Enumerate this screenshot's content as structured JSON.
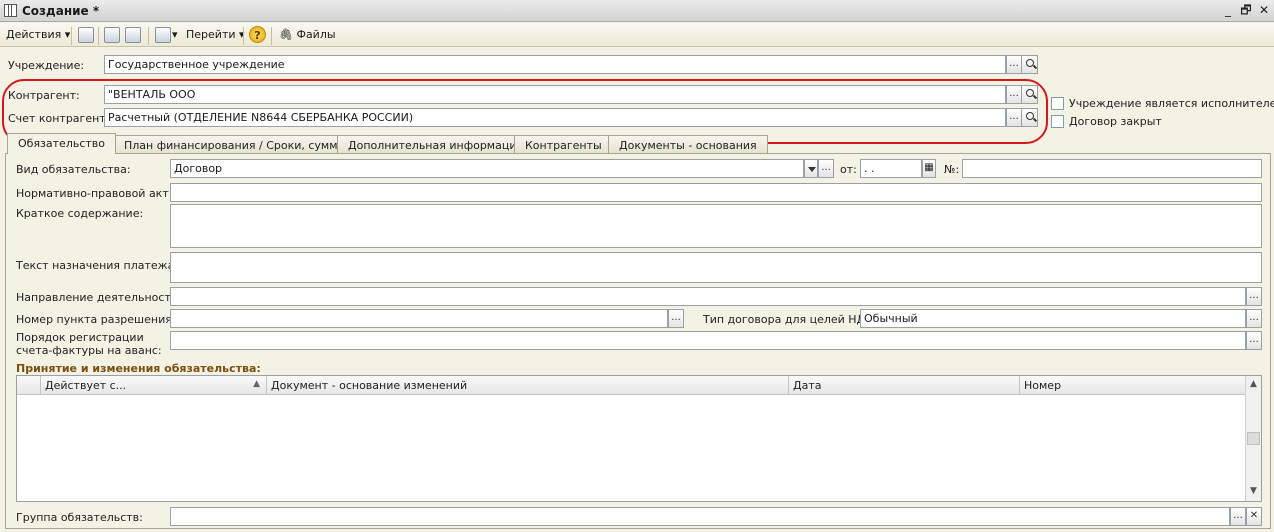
{
  "window": {
    "title": "Создание *",
    "minimize_glyph": "_",
    "restore_glyph": "🗗",
    "close_glyph": "✕"
  },
  "toolbar": {
    "actions_label": "Действия",
    "goto_label": "Перейти",
    "files_label": "Файлы",
    "help_glyph": "?",
    "dropdown_glyph": "▾",
    "attach_glyph": "🖇"
  },
  "header": {
    "institution_label": "Учреждение:",
    "institution_value": "Государственное учреждение",
    "counterparty_label": "Контрагент:",
    "counterparty_value": "\"ВЕНТАЛЬ ООО",
    "account_label": "Счет контрагента:",
    "account_value": "Расчетный (ОТДЕЛЕНИЕ N8644 СБЕРБАНКА РОССИИ)",
    "executor_checkbox_label": "Учреждение является исполнителем",
    "contract_closed_label": "Договор закрыт",
    "ellipsis": "...",
    "highlight_color": "#d21a1a"
  },
  "tabs": [
    {
      "label": "Обязательство",
      "active": true
    },
    {
      "label": "План финансирования / Сроки, суммы",
      "active": false
    },
    {
      "label": "Дополнительная информация",
      "active": false
    },
    {
      "label": "Контрагенты",
      "active": false
    },
    {
      "label": "Документы - основания",
      "active": false
    }
  ],
  "obligation": {
    "kind_label": "Вид обязательства:",
    "kind_value": "Договор",
    "from_label": "от:",
    "date_value": " .  .",
    "number_label": "№:",
    "number_value": "",
    "legal_act_label": "Нормативно-правовой акт:",
    "summary_label": "Краткое содержание:",
    "payment_text_label": "Текст назначения платежа:",
    "activity_label": "Направление деятельности:",
    "permit_label": "Номер пункта разрешения:",
    "vat_type_label": "Тип договора для целей НДС:",
    "vat_type_value": "Обычный",
    "invoice_order_label_1": "Порядок регистрации",
    "invoice_order_label_2": "счета-фактуры на аванс:",
    "changes_title": "Принятие и изменения обязательства:",
    "group_label": "Группа обязательств:",
    "clear_glyph": "✕",
    "calendar_glyph": "▦"
  },
  "grid": {
    "columns": [
      "Действует с...",
      "Документ - основание изменений",
      "Дата",
      "Номер"
    ],
    "sort_glyph": "▲",
    "scroll_up": "▲",
    "scroll_down": "▼",
    "rows": []
  }
}
